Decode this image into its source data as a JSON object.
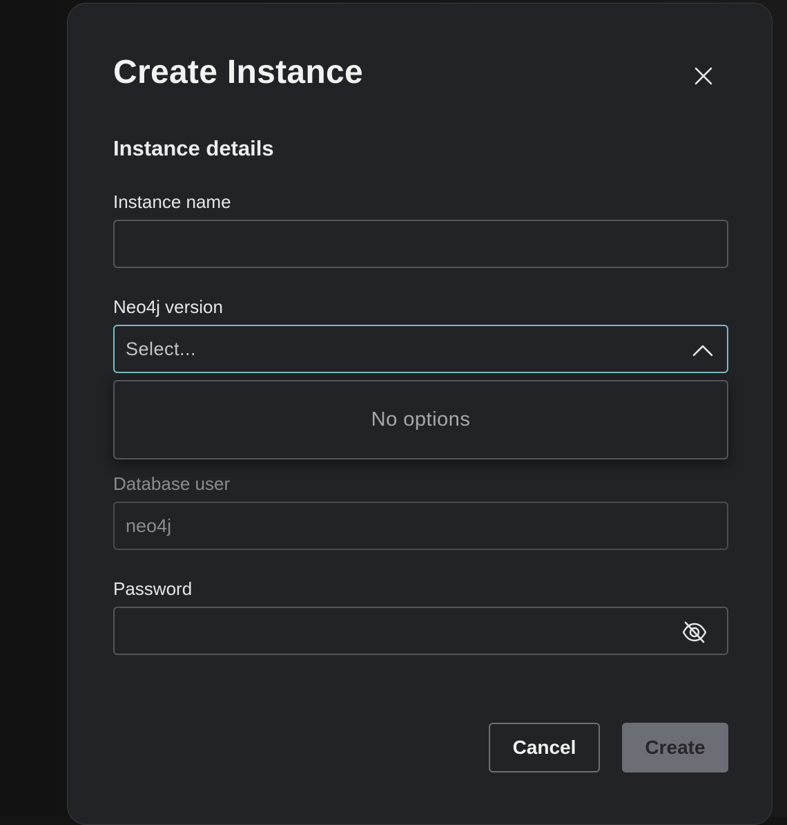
{
  "dialog": {
    "title": "Create Instance",
    "close_icon": "close-icon",
    "section_title": "Instance details"
  },
  "fields": {
    "instance_name": {
      "label": "Instance name",
      "value": ""
    },
    "neo4j_version": {
      "label": "Neo4j version",
      "placeholder": "Select...",
      "expanded": true,
      "chevron_icon": "chevron-up-icon"
    },
    "version_dropdown": {
      "empty_text": "No options"
    },
    "database_user": {
      "label": "Database user",
      "value": "neo4j",
      "disabled": true
    },
    "password": {
      "label": "Password",
      "value": "",
      "visibility_icon": "eye-off-icon"
    }
  },
  "actions": {
    "cancel_label": "Cancel",
    "create_label": "Create",
    "create_disabled": true
  },
  "colors": {
    "modal_bg": "#222326",
    "focus_border": "#79bcc4",
    "create_disabled_bg": "#6b6e75"
  }
}
